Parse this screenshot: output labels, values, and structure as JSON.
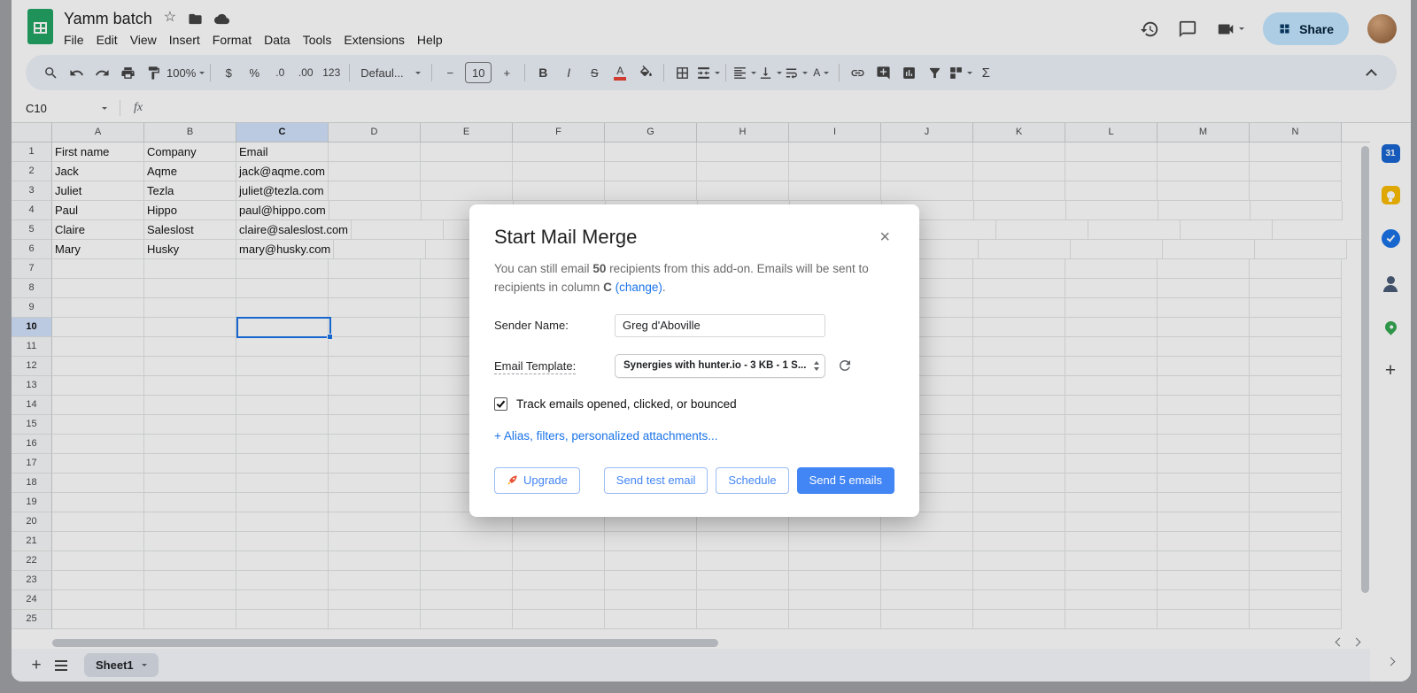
{
  "header": {
    "title": "Yamm batch",
    "menus": [
      "File",
      "Edit",
      "View",
      "Insert",
      "Format",
      "Data",
      "Tools",
      "Extensions",
      "Help"
    ],
    "share_label": "Share"
  },
  "toolbar": {
    "zoom": "100%",
    "currency": "$",
    "percent": "%",
    "decimal_decrease": ".0",
    "decimal_increase": ".00",
    "more_formats": "123",
    "font": "Defaul...",
    "minus": "−",
    "font_size": "10",
    "plus": "+",
    "bold": "B",
    "italic": "I",
    "strikethrough": "S",
    "text_color": "A",
    "rotate_letter": "A",
    "functions": "Σ"
  },
  "formula_bar": {
    "cell_ref": "C10",
    "fx": "fx"
  },
  "grid": {
    "columns": [
      "A",
      "B",
      "C",
      "D",
      "E",
      "F",
      "G",
      "H",
      "I",
      "J",
      "K",
      "L",
      "M",
      "N"
    ],
    "row_count": 25,
    "selected_col": "C",
    "selected_row": 10,
    "selected_cell": "C10",
    "cells": {
      "1": [
        "First name",
        "Company",
        "Email"
      ],
      "2": [
        "Jack",
        "Aqme",
        "jack@aqme.com"
      ],
      "3": [
        "Juliet",
        "Tezla",
        "juliet@tezla.com"
      ],
      "4": [
        "Paul",
        "Hippo",
        "paul@hippo.com"
      ],
      "5": [
        "Claire",
        "Saleslost",
        "claire@saleslost.com"
      ],
      "6": [
        "Mary",
        "Husky",
        "mary@husky.com"
      ]
    }
  },
  "tabs": {
    "add": "+",
    "active_sheet": "Sheet1"
  },
  "side_rail": {
    "calendar": "31",
    "add": "+"
  },
  "icons": {
    "star": "☆",
    "close": "×"
  },
  "colors": {
    "accent": "#4285f4",
    "link": "#1a73e8",
    "share_bg": "#c2e7ff",
    "selection": "#1a73e8"
  },
  "dialog": {
    "title": "Start Mail Merge",
    "intro": {
      "pre": "You can still email ",
      "count": "50",
      "mid": " recipients from this add-on. Emails will be sent to recipients in column ",
      "column": "C",
      "change_link": "(change)",
      "end": "."
    },
    "sender": {
      "label": "Sender Name:",
      "value": "Greg d'Aboville"
    },
    "template": {
      "label": "Email Template:",
      "value": "Synergies with hunter.io - 3 KB - 1 S..."
    },
    "tracking": {
      "label": "Track emails opened, clicked, or bounced",
      "checked": true
    },
    "alias_link": "+ Alias, filters, personalized attachments...",
    "buttons": {
      "upgrade": "Upgrade",
      "send_test": "Send test email",
      "schedule": "Schedule",
      "send": "Send 5 emails"
    }
  }
}
